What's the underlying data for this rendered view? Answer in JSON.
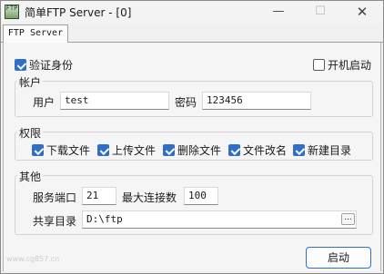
{
  "window": {
    "title": "简单FTP Server - [0]",
    "app_icon_text": "FTP",
    "min_glyph": "—",
    "max_glyph": "☐",
    "close_glyph": "✕"
  },
  "tabs": [
    {
      "label": "FTP Server",
      "selected": true
    }
  ],
  "auth": {
    "label": "验证身份",
    "checked": true
  },
  "autostart": {
    "label": "开机启动",
    "checked": false
  },
  "account": {
    "group_label": "帐户",
    "user_label": "用户",
    "user_value": "test",
    "password_label": "密码",
    "password_value": "123456"
  },
  "permissions": {
    "group_label": "权限",
    "items": [
      {
        "label": "下载文件",
        "checked": true
      },
      {
        "label": "上传文件",
        "checked": true
      },
      {
        "label": "删除文件",
        "checked": true
      },
      {
        "label": "文件改名",
        "checked": true
      },
      {
        "label": "新建目录",
        "checked": true
      }
    ]
  },
  "other": {
    "group_label": "其他",
    "port_label": "服务端口",
    "port_value": "21",
    "maxconn_label": "最大连接数",
    "maxconn_value": "100",
    "dir_label": "共享目录",
    "dir_value": "D:\\ftp",
    "browse_label": "..."
  },
  "start_button": "启动",
  "watermark": "www.cg857.cn",
  "colors": {
    "accent": "#2f6fc7",
    "window_bg": "#f0f0f0"
  }
}
